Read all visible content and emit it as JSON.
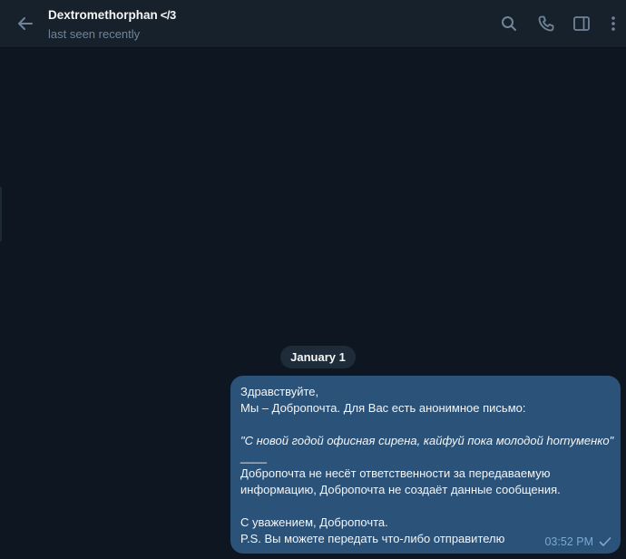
{
  "header": {
    "title": "Dextromethorphan",
    "title_emoji": "</3",
    "status": "last seen recently"
  },
  "chat": {
    "date_label": "January 1",
    "message": {
      "lines": [
        "Здравствуйте,",
        "Мы – Добропочта. Для Вас есть анонимное письмо:",
        "",
        "\"С новой годой офисная сирена, кайфуй пока молодой hornyменко\"",
        "____",
        "Добропочта не несёт ответственности за передаваемую",
        "информацию, Добропочта не создаёт данные сообщения.",
        "",
        "С уважением, Добропочта.",
        "P.S. Вы можете передать что-либо отправителю"
      ],
      "time": "03:52 PM"
    }
  },
  "colors": {
    "header_bg": "#17212b",
    "chat_bg": "#0e1621",
    "bubble_bg": "#2b5278",
    "muted_text": "#708499",
    "time_text": "#7da8d3"
  },
  "icons": {
    "back": "back-arrow-icon",
    "search": "search-icon",
    "call": "phone-icon",
    "panel": "sidebar-toggle-icon",
    "menu": "more-vertical-icon",
    "check": "check-icon"
  }
}
